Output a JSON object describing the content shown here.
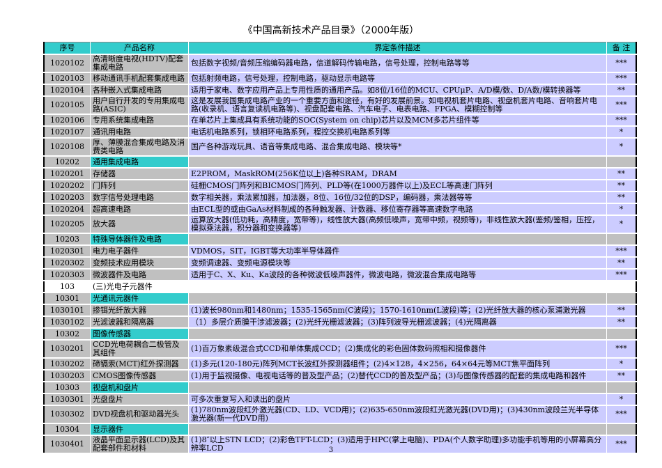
{
  "title": "《中国高新技术产品目录》（2000年版）",
  "headers": {
    "seq": "序号",
    "name": "产品名称",
    "desc": "界定条件描述",
    "note": "备 注"
  },
  "colors": {
    "header": "#33cccc",
    "gray": "#c0c0c0",
    "lavender": "#ccccff"
  },
  "rows": [
    {
      "type": "item",
      "seq": "1020102",
      "name": "高清晰度电视(HDTV)配套集成电路",
      "desc": "包括数字视频/音频压缩编码器电路，信道解码传输电路，信号处理，控制电路等等",
      "note": "***",
      "tall": true
    },
    {
      "type": "item",
      "seq": "1020103",
      "name": "移动通讯手机配套集成电路",
      "desc": "包括射频电路，信号处理，控制电路，驱动显示电路等",
      "note": "***"
    },
    {
      "type": "item",
      "seq": "1020104",
      "name": "各种嵌入式集成电路",
      "desc": "适用于家电、数字应用产品上专用性质的通用产品。如8位/16位的MCU、CPUμP、A/D模/数、D/A数/模转换器等",
      "note": "**"
    },
    {
      "type": "item",
      "seq": "1020105",
      "name": "用户自行开发的专用集成电路(ASIC)",
      "desc": "这是发展我国集成电路产业的一个重要方面和途径，有好的发展前景。如电视机套片电路、视盘机套片电路、音响套片电路(收录机、语言复读机电路等)、视盘配套电路、汽车电子、电表电路、FPGA、模糊控制等",
      "note": "***",
      "tall": true
    },
    {
      "type": "item",
      "seq": "1020106",
      "name": "专用系统集成电路",
      "desc": "在单芯片上集成具有系统功能的SOC(System on chip)芯片以及MCM多芯片组件等",
      "note": "***"
    },
    {
      "type": "item",
      "seq": "1020107",
      "name": "通讯用电路",
      "desc": "电话机电路系列，锁相环电路系列，程控交换机电路系列等",
      "note": "*"
    },
    {
      "type": "item",
      "seq": "1020108",
      "name": "厚、薄膜混合集成电路及消费类电路",
      "desc": "国产各种游戏玩具、语音等集成电路、混合集成电路、模块等*",
      "note": "*",
      "tall": true
    },
    {
      "type": "category",
      "seq": "10202",
      "name": "通用集成电路",
      "desc": "",
      "note": ""
    },
    {
      "type": "item",
      "seq": "1020201",
      "name": "存储器",
      "desc": "E2PROM，MaskROM(256K位以上)各种SRAM，DRAM",
      "note": "**"
    },
    {
      "type": "item",
      "seq": "1020202",
      "name": "门阵列",
      "desc": "硅栅CMOS门阵列和BICMOS门阵列、PLD等(在1000万器件以上)及ECL等高速门阵列",
      "note": "**"
    },
    {
      "type": "item",
      "seq": "1020203",
      "name": "数字信号处理电路",
      "desc": "数字相关器，乘法累加器，加法器，8位、16位/32位的DSP，编码器，乘法器等等",
      "note": "**"
    },
    {
      "type": "item",
      "seq": "1020204",
      "name": "超高速电路",
      "desc": "由ECL型的或由GaAs材料制成的各种触发器、计数器、移位寄存器等高速数字电路",
      "note": "*"
    },
    {
      "type": "item",
      "seq": "1020205",
      "name": "放大器",
      "desc": "运算放大器(低功耗，高精度，宽带等)，线性放大器(高频低噪声，宽带中频，视频等)，非线性放大器(鉴频/鉴相，压控，模拟乘法器，积分器和变换器等)",
      "note": "*",
      "tall": true
    },
    {
      "type": "category",
      "seq": "10203",
      "name": "特殊导体器件及电路",
      "desc": "",
      "note": ""
    },
    {
      "type": "item",
      "seq": "1020301",
      "name": "电力电子器件",
      "desc": "VDMOS，SIT，IGBT等大功率半导体器件",
      "note": "***"
    },
    {
      "type": "item",
      "seq": "1020302",
      "name": "变频技术应用模块",
      "desc": "变频调速器、变频电源模块等",
      "note": "**"
    },
    {
      "type": "item",
      "seq": "1020303",
      "name": "微波器件及电路",
      "desc": "适用于C、X、Ku、Ka波段的各种微波低噪声器件，微波电路，微波混合集成电路等",
      "note": "***"
    },
    {
      "type": "section",
      "seq": "103",
      "name": "(三)光电子元器件",
      "desc": "",
      "note": ""
    },
    {
      "type": "category",
      "seq": "10301",
      "name": "光通讯元器件",
      "desc": "",
      "note": ""
    },
    {
      "type": "item",
      "seq": "1030101",
      "name": "掺铒光纤放大器",
      "desc": "(1)波长980nm和1480nm；1535-1565nm(C波段)；1570-1610nm(L波段)等；(2)光纤放大器的核心泵浦激光器",
      "note": "**"
    },
    {
      "type": "item",
      "seq": "1030102",
      "name": "光滤波器和隔离器",
      "desc": "（1）多层介质膜干涉滤波器；(2)光纤光栅滤波器；(3)阵列波导光栅滤波器；(4)光隔离器",
      "note": "**"
    },
    {
      "type": "category",
      "seq": "10302",
      "name": "图像传感器",
      "desc": "",
      "note": ""
    },
    {
      "type": "item",
      "seq": "1030201",
      "name": "CCD光电荷耦合二极管及其组件",
      "desc": "(1)百万象素级混合式CCD和单体集成CCD；(2)集成化的彩色固体数码照相和摄像器件",
      "note": "***",
      "tall": true
    },
    {
      "type": "item",
      "seq": "1030202",
      "name": "碲镉汞(MCT)红外探测器",
      "desc": "(1)多元(120-180元)阵列MCT长波红外探测器组件；(2)4×128，4×256，64×64元等MCT焦平面阵列",
      "note": "*"
    },
    {
      "type": "item",
      "seq": "1030203",
      "name": "CMOS图像传感器",
      "desc": "(1)用于监视摄像、电视电话等的普及型产品；(2)替代CCD的普及型产品；(3)与图像传感器的配套的集成电路和器件",
      "note": "**"
    },
    {
      "type": "category",
      "seq": "10303",
      "name": "视盘机和盘片",
      "desc": "",
      "note": ""
    },
    {
      "type": "item",
      "seq": "1030301",
      "name": "光盘盘片",
      "desc": "可多次重复写入和读出的盘片",
      "note": "*"
    },
    {
      "type": "item",
      "seq": "1030302",
      "name": "DVD视盘机和驱动器光头",
      "desc": "(1)780nm波段红外激光器(CD、LD、VCD用)；(2)635-650nm波段红光激光器(DVD用)；(3)430nm波段兰光半导体激光器(新一代DVD用)",
      "note": "***"
    },
    {
      "type": "category",
      "seq": "10304",
      "name": "显示器件",
      "desc": "",
      "note": ""
    },
    {
      "type": "item",
      "seq": "1030401",
      "name": "液晶平面显示器(LCD)及其配套部件和材料",
      "desc": "(1)8″以上STN LCD；(2)彩色TFT-LCD；(3)适用于HPC(掌上电脑)、PDA(个人数字助理)多功能手机等用的小屏幕高分辨率LCD",
      "note": "***",
      "tall": true
    }
  ],
  "page_number": "3"
}
